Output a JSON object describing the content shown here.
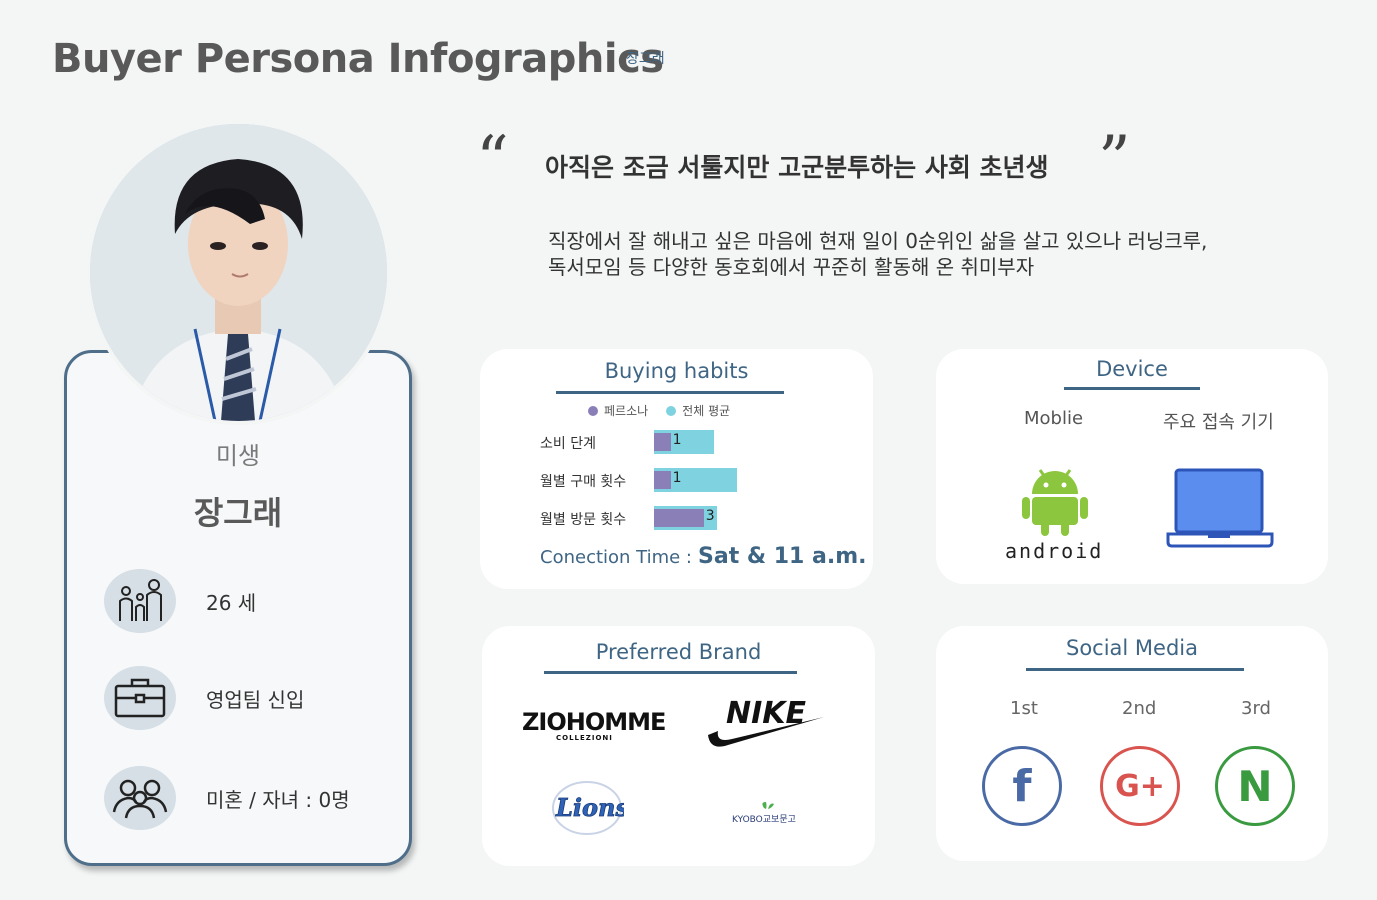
{
  "header": {
    "title": "Buyer Persona Infographics",
    "subtitle": "장그래"
  },
  "profile": {
    "role": "미생",
    "name": "장그래",
    "age": "26 세",
    "job": "영업팀 신입",
    "family": "미혼 / 자녀 : 0명"
  },
  "quote": {
    "open": "“",
    "close": "”",
    "headline": "아직은 조금 서툴지만 고군분투하는 사회 초년생",
    "description_line1": "직장에서 잘 해내고 싶은 마음에 현재 일이 0순위인 삶을 살고 있으나 러닝크루,",
    "description_line2": "독서모임 등 다양한 동호회에서 꾸준히 활동해 온 취미부자"
  },
  "buying_habits": {
    "title": "Buying habits",
    "legend_persona": "페르소나",
    "legend_average": "전체 평균",
    "connection_label": "Conection Time :",
    "connection_value": "Sat & 11 a.m."
  },
  "chart_data": {
    "type": "bar",
    "orientation": "horizontal",
    "categories": [
      "소비 단계",
      "월별 구매 횟수",
      "월별 방문 횟수"
    ],
    "series": [
      {
        "name": "페르소나",
        "values": [
          1,
          1,
          3
        ],
        "color": "#8b7fb8"
      },
      {
        "name": "전체 평균",
        "values": [
          3.6,
          5,
          3.8
        ],
        "color": "#7fd3e0"
      }
    ],
    "data_labels": [
      "1",
      "1",
      "3"
    ],
    "legend_position": "top"
  },
  "device": {
    "title": "Device",
    "col1": "Moblie",
    "col2": "주요 접속 기기",
    "android_text": "android"
  },
  "brand": {
    "title": "Preferred Brand",
    "brand1": "ZIOHOMME",
    "brand1_sub": "COLLEZIONI",
    "brand2": "NIKE",
    "brand3": "Lions",
    "brand4": "KYOBO교보문고"
  },
  "social": {
    "title": "Social Media",
    "rank1": "1st",
    "rank2": "2nd",
    "rank3": "3rd",
    "icon1": "f",
    "icon2": "G+",
    "icon3": "N",
    "colors": {
      "facebook": "#4a6aa6",
      "google": "#d9534f",
      "naver": "#3a9a40"
    }
  },
  "colors": {
    "accent": "#3f6584",
    "card_border": "#4e6e8a"
  }
}
